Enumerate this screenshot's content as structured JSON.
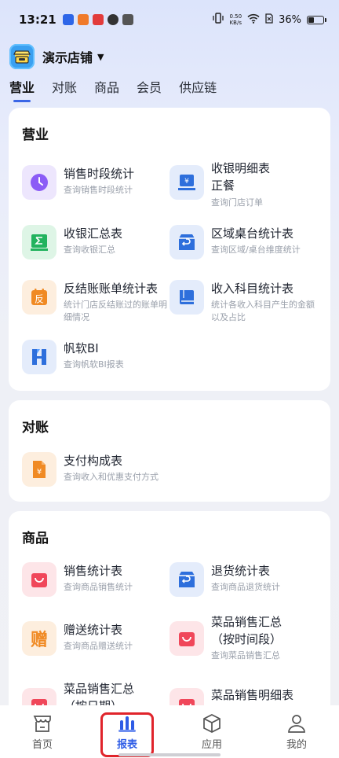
{
  "status": {
    "time": "13:21",
    "speed_value": "0.50",
    "speed_unit": "KB/s",
    "battery": "36%"
  },
  "store": {
    "name": "演示店铺"
  },
  "tabs": [
    "营业",
    "对账",
    "商品",
    "会员",
    "供应链"
  ],
  "sections": {
    "business": {
      "title": "营业",
      "items": [
        {
          "title": "销售时段统计",
          "sub": "查询销售时段统计",
          "icon": "clock-icon"
        },
        {
          "title": "收银明细表\n正餐",
          "sub": "查询门店订单",
          "icon": "register-icon"
        },
        {
          "title": "收银汇总表",
          "sub": "查询收银汇总",
          "icon": "sum-icon"
        },
        {
          "title": "区域桌台统计表",
          "sub": "查询区域/桌台维度统计",
          "icon": "box-return-icon"
        },
        {
          "title": "反结账账单统计表",
          "sub": "统计门店反结账过的账单明细情况",
          "icon": "reverse-icon"
        },
        {
          "title": "收入科目统计表",
          "sub": "统计各收入科目产生的金额以及占比",
          "icon": "book-icon"
        },
        {
          "title": "帆软BI",
          "sub": "查询帆软BI报表",
          "icon": "finereport-icon"
        }
      ]
    },
    "reconcile": {
      "title": "对账",
      "items": [
        {
          "title": "支付构成表",
          "sub": "查询收入和优惠支付方式",
          "icon": "payment-icon"
        }
      ]
    },
    "goods": {
      "title": "商品",
      "items": [
        {
          "title": "销售统计表",
          "sub": "查询商品销售统计",
          "icon": "bag-icon"
        },
        {
          "title": "退货统计表",
          "sub": "查询商品退货统计",
          "icon": "box-return-icon"
        },
        {
          "title": "赠送统计表",
          "sub": "查询商品赠送统计",
          "icon": "gift-char-icon"
        },
        {
          "title": "菜品销售汇总\n（按时间段）",
          "sub": "查询菜品销售汇总",
          "icon": "bag-icon"
        },
        {
          "title": "菜品销售汇总\n（按日期）",
          "sub": "",
          "icon": "bag-icon"
        },
        {
          "title": "菜品销售明细表",
          "sub": "",
          "icon": "bag-icon"
        }
      ]
    }
  },
  "icon_glyphs": {
    "reverse": "反",
    "gift": "赠",
    "yen": "¥"
  },
  "nav": [
    {
      "label": "首页",
      "icon": "home-icon"
    },
    {
      "label": "报表",
      "icon": "report-icon"
    },
    {
      "label": "应用",
      "icon": "cube-icon"
    },
    {
      "label": "我的",
      "icon": "user-icon"
    }
  ],
  "colors": {
    "accent": "#2e5ce6",
    "highlight": "#e0242b",
    "purple": "#8b5cf6",
    "blue": "#2e6fdc",
    "green": "#22b35e",
    "orange": "#f08a24",
    "red": "#f0475a"
  }
}
